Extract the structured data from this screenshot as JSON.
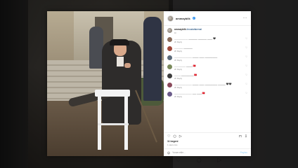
{
  "post": {
    "username": "ammaybilk",
    "caption_username": "ammaybilk",
    "caption_text": "#mustafakemal",
    "caption_meta": "1h"
  },
  "comments": [
    {
      "user": "___________",
      "text": "_______ _______ ____ 🖤",
      "meta": "2h  Reply",
      "color": "#8a6d5b"
    },
    {
      "user": "_______",
      "text": "_______",
      "meta": "2h  Reply",
      "color": "#a04a3b"
    },
    {
      "user": "______________",
      "text": "_____ ____ __________",
      "meta": "2h  Reply",
      "color": "#5c6b7a"
    },
    {
      "user": "_________",
      "text": "_____ 🇹🇷",
      "meta": "2h  Reply",
      "color": "#7a8a5c"
    },
    {
      "user": "_____",
      "text": "__________ 🇹🇷",
      "meta": "2h  Reply",
      "color": "#3d3d3d"
    },
    {
      "user": "______________",
      "text": "_____ ____ __________ ______ 🖤🖤",
      "meta": "2h  Reply",
      "color": "#8a4a5b"
    },
    {
      "user": "______________",
      "text": "___ ____ 🇹🇷",
      "meta": "2h  Reply",
      "color": "#6b5c8a"
    }
  ],
  "actions": {
    "like_icon": "♡",
    "comment_icon": "○",
    "share_icon": "▷",
    "save_icon": "⊓",
    "extra_icon": "⇩"
  },
  "likes": "11 begeni",
  "date": "1 saat once",
  "add_comment": {
    "emoji": "☺",
    "placeholder": "Yorum ekle...",
    "post_label": "Paylas"
  },
  "background": {
    "actions_text": "♡ ○ ▷"
  }
}
